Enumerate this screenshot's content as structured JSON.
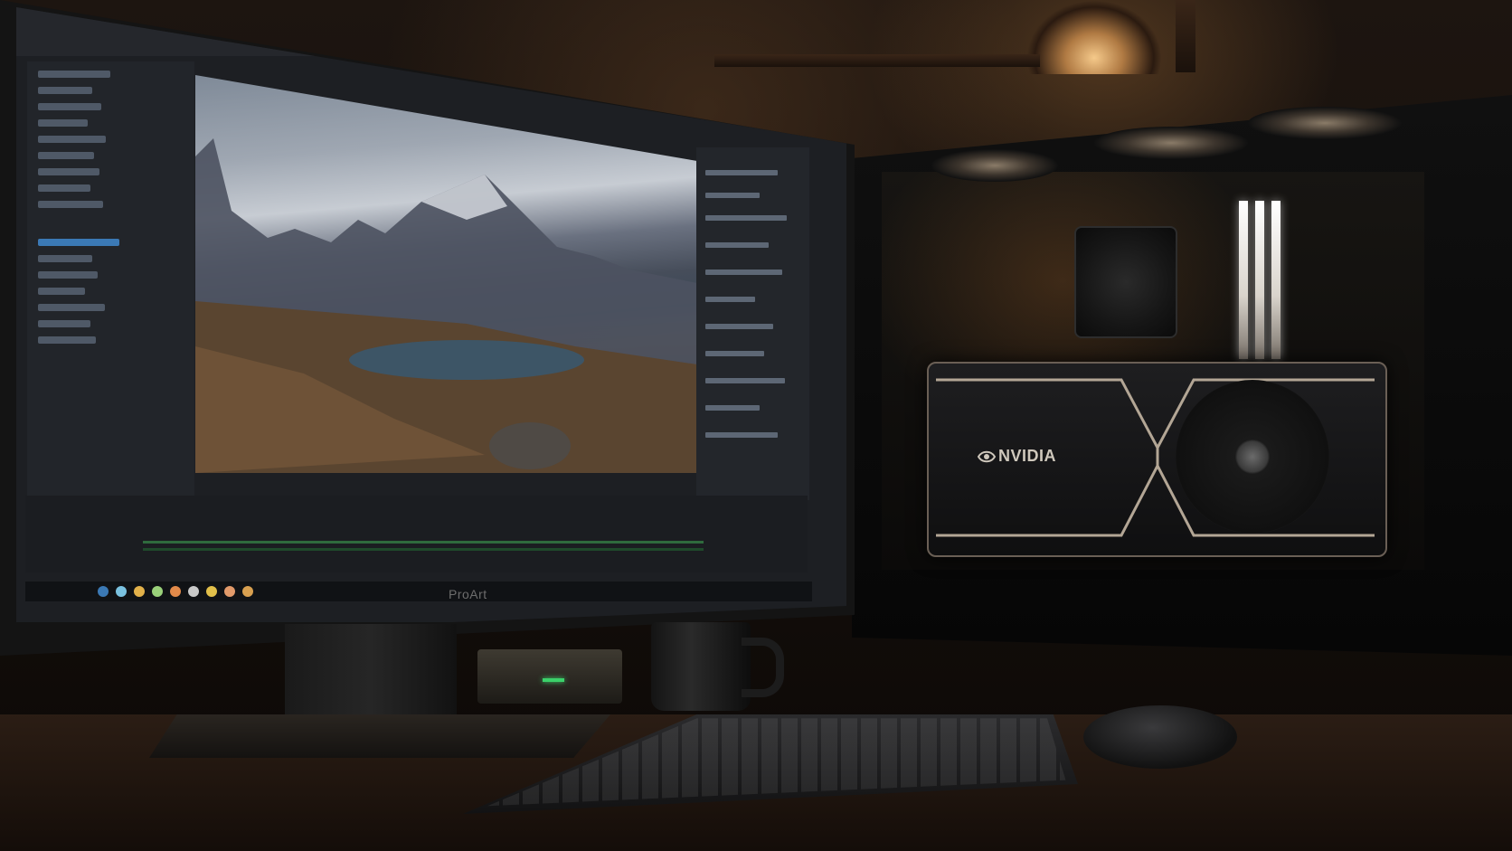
{
  "scene": {
    "monitor_brand": "ProArt",
    "gpu_brand": "NVIDIA"
  },
  "colors": {
    "ui_accent": "#3b79b5",
    "waveform": "#2f6a3d",
    "ambient_light": "#e48a3c"
  }
}
